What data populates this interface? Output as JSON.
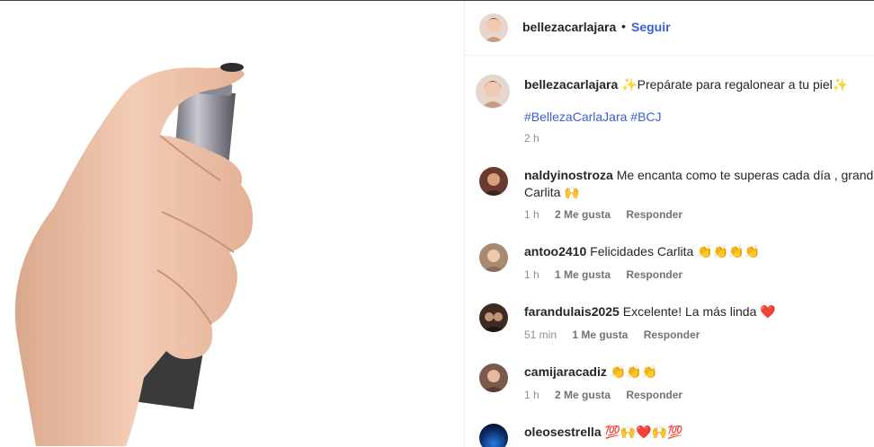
{
  "post": {
    "author": "bellezacarlajara",
    "follow_label": "Seguir",
    "separator": "•",
    "caption": "✨Prepárate para regalonear a tu piel✨",
    "hashtags": "#BellezaCarlaJara #BCJ",
    "time": "2 h"
  },
  "comments": [
    {
      "user": "naldyinostroza",
      "text": "Me encanta como te superas cada día , grande",
      "text2": "Carlita 🙌",
      "time": "1 h",
      "likes": "2 Me gusta",
      "reply": "Responder"
    },
    {
      "user": "antoo2410",
      "text": "Felicidades Carlita 👏👏👏👏",
      "time": "1 h",
      "likes": "1 Me gusta",
      "reply": "Responder"
    },
    {
      "user": "farandulais2025",
      "text": "Excelente! La más linda ❤️",
      "time": "51 min",
      "likes": "1 Me gusta",
      "reply": "Responder"
    },
    {
      "user": "camijaracadiz",
      "text": "👏👏👏",
      "time": "1 h",
      "likes": "2 Me gusta",
      "reply": "Responder"
    },
    {
      "user": "oleosestrella",
      "text": "💯🙌❤️🙌💯"
    }
  ]
}
